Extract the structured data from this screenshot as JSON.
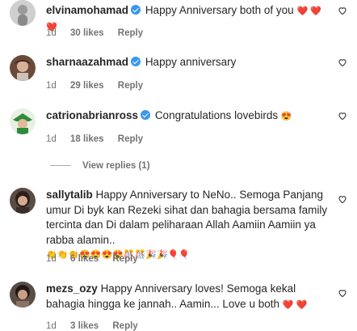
{
  "comments": [
    {
      "username": "elvinamohamad",
      "verified": true,
      "text": "Happy Anniversary both of you",
      "emojis": "❤️ ❤️ ❤️",
      "time": "1d",
      "likes": "30 likes",
      "reply": "Reply"
    },
    {
      "username": "sharnaazahmad",
      "verified": true,
      "text": "Happy anniversary",
      "time": "1d",
      "likes": "29 likes",
      "reply": "Reply"
    },
    {
      "username": "catrionabrianross",
      "verified": true,
      "text": "Congratulations lovebirds",
      "emojis": "😍",
      "time": "1d",
      "likes": "18 likes",
      "reply": "Reply",
      "view_replies": "View replies (1)"
    },
    {
      "username": "sallytalib",
      "verified": false,
      "text": "Happy Anniversary to NeNo.. Semoga Panjang umur Di byk kan Rezeki sihat dan bahagia bersama family tercinta dan Di dalam peliharaan Allah Aamiin Aamiin ya rabba alamin..",
      "emojis": "👏👏👏😍😍😍😍🎊🎊🎉🎉🎈🎈",
      "time": "1d",
      "likes": "6 likes",
      "reply": "Reply"
    },
    {
      "username": "mezs_ozy",
      "verified": false,
      "text": "Happy Anniversary loves! Semoga kekal bahagia hingga ke jannah.. Aamin... Love u both",
      "emojis": "❤️ ❤️",
      "time": "1d",
      "likes": "3 likes",
      "reply": "Reply"
    }
  ],
  "colors": {
    "text": "#262626",
    "meta": "#737373",
    "verified": "#3897f0",
    "heart_emoji": "#ed1c24"
  },
  "icons": [
    "verified-badge-icon",
    "heart-outline-icon"
  ]
}
